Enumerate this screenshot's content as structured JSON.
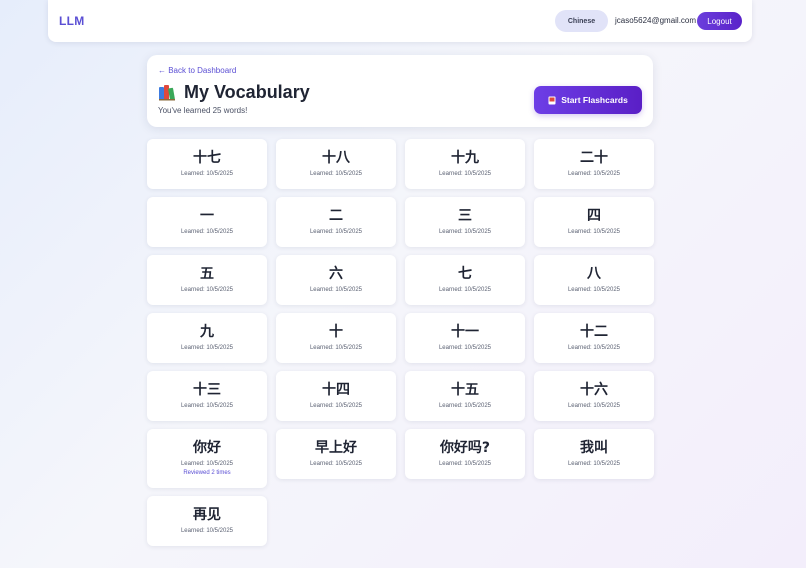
{
  "nav": {
    "logo": "LLM",
    "language": "Chinese",
    "email": "jcaso5624@gmail.com",
    "logout_label": "Logout",
    "accent_color": "#5b4fd4"
  },
  "header": {
    "back_label": "← Back to Dashboard",
    "icon": "books-icon",
    "title": "My Vocabulary",
    "subtitle": "You've learned 25 words!",
    "flashcards_icon": "card-icon",
    "flashcards_label": "Start Flashcards"
  },
  "words": [
    {
      "word": "十七",
      "learned": "Learned: 10/5/2025"
    },
    {
      "word": "十八",
      "learned": "Learned: 10/5/2025"
    },
    {
      "word": "十九",
      "learned": "Learned: 10/5/2025"
    },
    {
      "word": "二十",
      "learned": "Learned: 10/5/2025"
    },
    {
      "word": "一",
      "learned": "Learned: 10/5/2025"
    },
    {
      "word": "二",
      "learned": "Learned: 10/5/2025"
    },
    {
      "word": "三",
      "learned": "Learned: 10/5/2025"
    },
    {
      "word": "四",
      "learned": "Learned: 10/5/2025"
    },
    {
      "word": "五",
      "learned": "Learned: 10/5/2025"
    },
    {
      "word": "六",
      "learned": "Learned: 10/5/2025"
    },
    {
      "word": "七",
      "learned": "Learned: 10/5/2025"
    },
    {
      "word": "八",
      "learned": "Learned: 10/5/2025"
    },
    {
      "word": "九",
      "learned": "Learned: 10/5/2025"
    },
    {
      "word": "十",
      "learned": "Learned: 10/5/2025"
    },
    {
      "word": "十一",
      "learned": "Learned: 10/5/2025"
    },
    {
      "word": "十二",
      "learned": "Learned: 10/5/2025"
    },
    {
      "word": "十三",
      "learned": "Learned: 10/5/2025"
    },
    {
      "word": "十四",
      "learned": "Learned: 10/5/2025"
    },
    {
      "word": "十五",
      "learned": "Learned: 10/5/2025"
    },
    {
      "word": "十六",
      "learned": "Learned: 10/5/2025"
    },
    {
      "word": "你好",
      "learned": "Learned: 10/5/2025",
      "reviewed": "Reviewed 2 times"
    },
    {
      "word": "早上好",
      "learned": "Learned: 10/5/2025"
    },
    {
      "word": "你好吗?",
      "learned": "Learned: 10/5/2025"
    },
    {
      "word": "我叫",
      "learned": "Learned: 10/5/2025"
    },
    {
      "word": "再见",
      "learned": "Learned: 10/5/2025"
    }
  ]
}
